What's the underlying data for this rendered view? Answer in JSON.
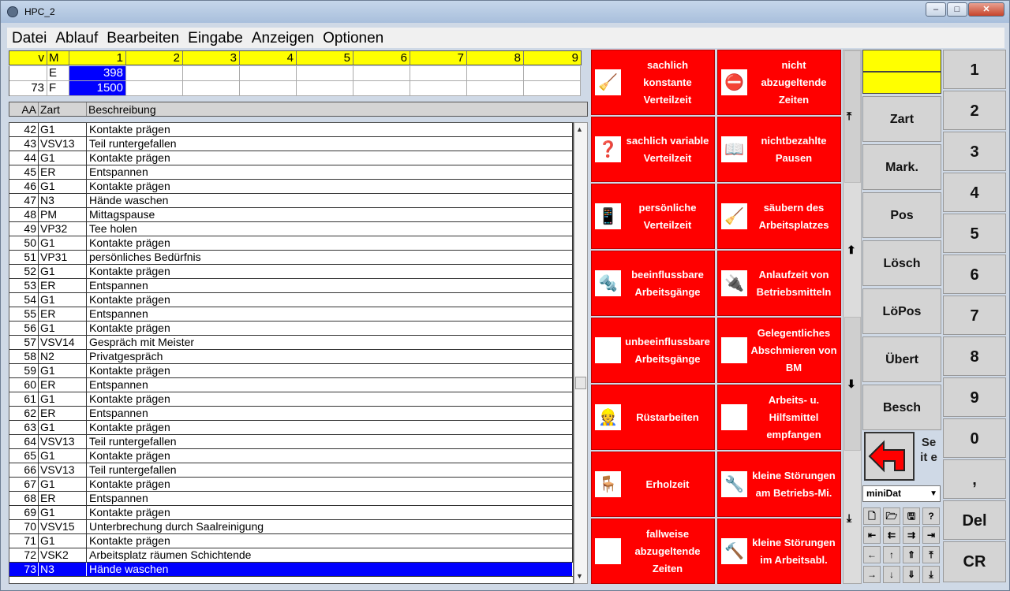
{
  "window": {
    "title": "HPC_2",
    "min": "–",
    "max": "□",
    "close": "✕"
  },
  "menu": [
    "Datei",
    "Ablauf",
    "Bearbeiten",
    "Eingabe",
    "Anzeigen",
    "Optionen"
  ],
  "grid": {
    "headers": [
      "v",
      "M",
      "1",
      "2",
      "3",
      "4",
      "5",
      "6",
      "7",
      "8",
      "9"
    ],
    "rows": [
      {
        "v": "",
        "m": "E",
        "c1": "398"
      },
      {
        "v": "73",
        "m": "F",
        "c1": "1500"
      }
    ]
  },
  "list": {
    "headers": [
      "AA",
      "Zart",
      "Beschreibung"
    ],
    "rows": [
      [
        "42",
        "G1",
        "Kontakte prägen"
      ],
      [
        "43",
        "VSV13",
        "Teil runtergefallen"
      ],
      [
        "44",
        "G1",
        "Kontakte prägen"
      ],
      [
        "45",
        "ER",
        "Entspannen"
      ],
      [
        "46",
        "G1",
        "Kontakte prägen"
      ],
      [
        "47",
        "N3",
        "Hände waschen"
      ],
      [
        "48",
        "PM",
        "Mittagspause"
      ],
      [
        "49",
        "VP32",
        "Tee holen"
      ],
      [
        "50",
        "G1",
        "Kontakte prägen"
      ],
      [
        "51",
        "VP31",
        "persönliches Bedürfnis"
      ],
      [
        "52",
        "G1",
        "Kontakte prägen"
      ],
      [
        "53",
        "ER",
        "Entspannen"
      ],
      [
        "54",
        "G1",
        "Kontakte prägen"
      ],
      [
        "55",
        "ER",
        "Entspannen"
      ],
      [
        "56",
        "G1",
        "Kontakte prägen"
      ],
      [
        "57",
        "VSV14",
        "Gespräch mit Meister"
      ],
      [
        "58",
        "N2",
        "Privatgespräch"
      ],
      [
        "59",
        "G1",
        "Kontakte prägen"
      ],
      [
        "60",
        "ER",
        "Entspannen"
      ],
      [
        "61",
        "G1",
        "Kontakte prägen"
      ],
      [
        "62",
        "ER",
        "Entspannen"
      ],
      [
        "63",
        "G1",
        "Kontakte prägen"
      ],
      [
        "64",
        "VSV13",
        "Teil runtergefallen"
      ],
      [
        "65",
        "G1",
        "Kontakte prägen"
      ],
      [
        "66",
        "VSV13",
        "Teil runtergefallen"
      ],
      [
        "67",
        "G1",
        "Kontakte prägen"
      ],
      [
        "68",
        "ER",
        "Entspannen"
      ],
      [
        "69",
        "G1",
        "Kontakte prägen"
      ],
      [
        "70",
        "VSV15",
        "Unterbrechung durch Saalreinigung"
      ],
      [
        "71",
        "G1",
        "Kontakte prägen"
      ],
      [
        "72",
        "VSK2",
        "Arbeitsplatz räumen Schichtende"
      ],
      [
        "73",
        "N3",
        "Hände waschen"
      ]
    ],
    "selected_index": 31
  },
  "categories": [
    {
      "label": "sachlich konstante Verteilzeit",
      "icon": "vacuum-icon"
    },
    {
      "label": "nicht abzugeltende Zeiten",
      "icon": "no-entry-icon"
    },
    {
      "label": "sachlich variable Verteilzeit",
      "icon": "question-tool-icon"
    },
    {
      "label": "nichtbezahlte Pausen",
      "icon": "reading-person-icon"
    },
    {
      "label": "persönliche Verteilzeit",
      "icon": "phone-icon"
    },
    {
      "label": "säubern des Arbeitsplatzes",
      "icon": "broom-icon"
    },
    {
      "label": "beeinflussbare Arbeitsgänge",
      "icon": "drill-icon"
    },
    {
      "label": "Anlaufzeit von Betriebsmitteln",
      "icon": "plug-icon"
    },
    {
      "label": "unbeeinflussbare Arbeitsgänge",
      "icon": "machine-icon"
    },
    {
      "label": "Gelegentliches Abschmieren von BM",
      "icon": "grease-gun-icon"
    },
    {
      "label": "Rüstarbeiten",
      "icon": "worker-icon"
    },
    {
      "label": "Arbeits- u. Hilfsmittel empfangen",
      "icon": "receive-tools-icon"
    },
    {
      "label": "Erholzeit",
      "icon": "resting-person-icon"
    },
    {
      "label": "kleine Störungen am Betriebs-Mi.",
      "icon": "wrench-icon"
    },
    {
      "label": "fallweise abzugeltende Zeiten",
      "icon": "digging-person-icon"
    },
    {
      "label": "kleine Störungen im Arbeitsabl.",
      "icon": "hammer-person-icon"
    }
  ],
  "side_buttons": [
    "Zart",
    "Mark.",
    "Pos",
    "Lösch",
    "LöPos",
    "Übert",
    "Besch"
  ],
  "numpad": [
    "1",
    "2",
    "3",
    "4",
    "5",
    "6",
    "7",
    "8",
    "9",
    "0",
    ",",
    "Del",
    "CR"
  ],
  "seite": "Se it e",
  "combo": {
    "value": "miniDat"
  },
  "colors": {
    "red": "#ff0000",
    "yellow": "#ffff00",
    "select": "#0000ff"
  }
}
